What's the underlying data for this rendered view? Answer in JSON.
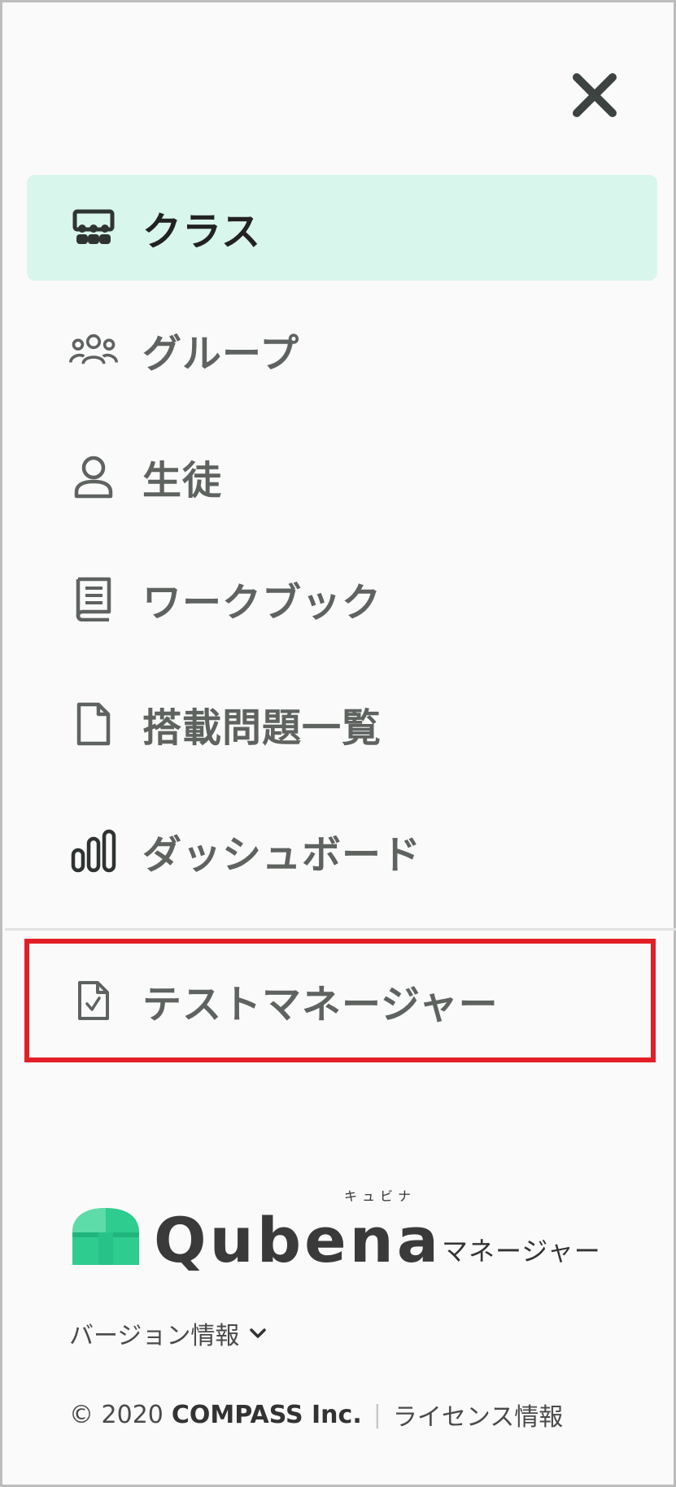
{
  "nav": {
    "items": [
      {
        "label": "クラス",
        "icon": "class-icon",
        "active": true
      },
      {
        "label": "グループ",
        "icon": "group-icon"
      },
      {
        "label": "生徒",
        "icon": "student-icon"
      },
      {
        "label": "ワークブック",
        "icon": "workbook-icon"
      },
      {
        "label": "搭載問題一覧",
        "icon": "document-icon"
      },
      {
        "label": "ダッシュボード",
        "icon": "bar-chart-icon"
      }
    ],
    "secondary": [
      {
        "label": "テストマネージャー",
        "icon": "test-document-icon"
      }
    ]
  },
  "logo": {
    "word": "Qubena",
    "ruby": "キュビナ",
    "sub": "マネージャー"
  },
  "version": {
    "label": "バージョン情報"
  },
  "footer": {
    "copyright": "© 2020",
    "company": "COMPASS Inc.",
    "separator": "|",
    "license": "ライセンス情報"
  },
  "colors": {
    "active_bg": "#d9f6ec",
    "highlight": "#e21f26",
    "brand_green": "#2ecc8f"
  }
}
